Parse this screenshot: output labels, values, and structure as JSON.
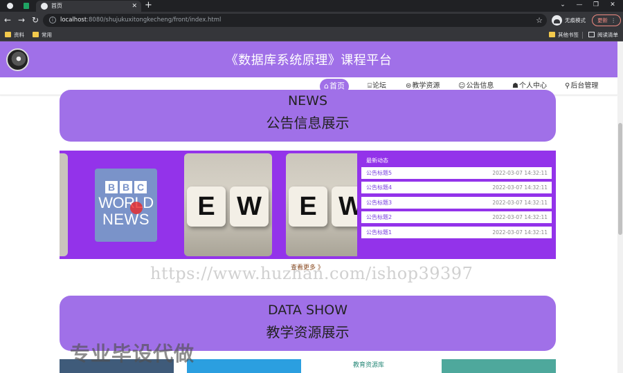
{
  "browser": {
    "active_tab_title": "首页",
    "url_host": "localhost",
    "url_rest": ":8080/shujukuxitongkecheng/front/index.html",
    "profile_mode": "无痕模式",
    "update_label": "更新",
    "bookmarks": [
      "资料",
      "常用"
    ],
    "bookmarks_right": [
      "其他书签",
      "阅读清单"
    ]
  },
  "site": {
    "title": "《数据库系统原理》课程平台",
    "accent_color": "#a070e8",
    "nav": [
      {
        "icon": "⌂",
        "label": "首页"
      },
      {
        "icon": "⌸",
        "label": "论坛"
      },
      {
        "icon": "⊜",
        "label": "教学资源"
      },
      {
        "icon": "☺",
        "label": "公告信息"
      },
      {
        "icon": "☗",
        "label": "个人中心"
      },
      {
        "icon": "⚲",
        "label": "后台管理"
      }
    ]
  },
  "news_section": {
    "title_en": "NEWS",
    "title_zh": "公告信息展示",
    "carousel": {
      "bbc_letters": [
        "B",
        "B",
        "C"
      ],
      "bbc_line1": "WORLD",
      "bbc_line2": "NEWS",
      "dice_letters": [
        "E",
        "W"
      ]
    },
    "panel_heading": "最新动态",
    "items": [
      {
        "title": "公告标题5",
        "date": "2022-03-07 14:32:11"
      },
      {
        "title": "公告标题4",
        "date": "2022-03-07 14:32:11"
      },
      {
        "title": "公告标题3",
        "date": "2022-03-07 14:32:11"
      },
      {
        "title": "公告标题2",
        "date": "2022-03-07 14:32:11"
      },
      {
        "title": "公告标题1",
        "date": "2022-03-07 14:32:11"
      }
    ],
    "more_label": "查看更多 》"
  },
  "data_section": {
    "title_en": "DATA SHOW",
    "title_zh": "教学资源展示",
    "thumb_caption": "教育资源库"
  },
  "watermarks": {
    "url": "https://www.huzhan.com/ishop39397",
    "cn": "专业毕设代做"
  }
}
